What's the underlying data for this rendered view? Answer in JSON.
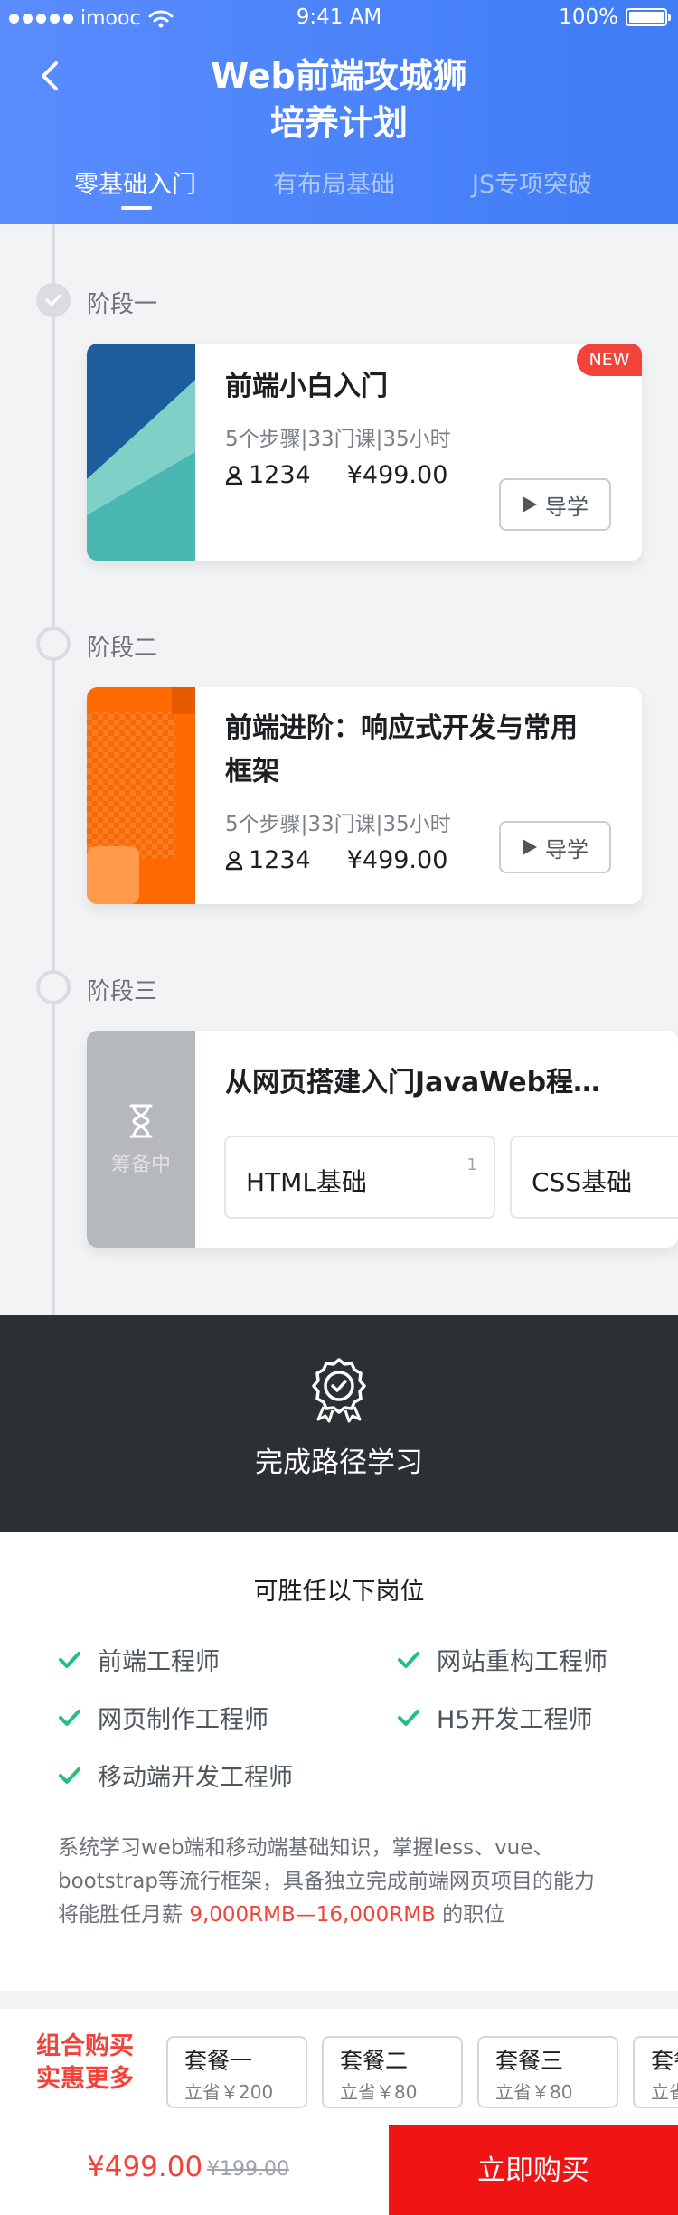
{
  "status_bar": {
    "carrier": "imooc",
    "time": "9:41 AM",
    "battery": "100%"
  },
  "header": {
    "title_line1": "Web前端攻城狮",
    "title_line2": "培养计划",
    "tabs": [
      {
        "label": "零基础入门",
        "active": true
      },
      {
        "label": "有布局基础",
        "active": false
      },
      {
        "label": "JS专项突破",
        "active": false
      }
    ]
  },
  "stages": [
    {
      "label": "阶段一",
      "completed": true
    },
    {
      "label": "阶段二",
      "completed": false
    },
    {
      "label": "阶段三",
      "completed": false
    }
  ],
  "courses": [
    {
      "title": "前端小白入门",
      "meta": "5个步骤|33门课|35小时",
      "learners": "1234",
      "price": "¥499.00",
      "guide_label": "导学",
      "badge": "NEW"
    },
    {
      "title_line1": "前端进阶：响应式开发与常用",
      "title_line2": "框架",
      "meta": "5个步骤|33门课|35小时",
      "learners": "1234",
      "price": "¥499.00",
      "guide_label": "导学"
    },
    {
      "title": "从网页搭建入门JavaWeb程…",
      "cover_label": "筹备中",
      "chips": [
        {
          "label": "HTML基础",
          "num": "1"
        },
        {
          "label": "CSS基础"
        }
      ]
    }
  ],
  "completion": {
    "title": "完成路径学习"
  },
  "jobs": {
    "title": "可胜任以下岗位",
    "items": [
      "前端工程师",
      "网站重构工程师",
      "网页制作工程师",
      "H5开发工程师",
      "移动端开发工程师"
    ],
    "desc_line1": "系统学习web端和移动端基础知识，掌握less、vue、",
    "desc_line2": "bootstrap等流行框架，具备独立完成前端网页项目的能力",
    "desc_line3_prefix": "将能胜任月薪 ",
    "salary": "9,000RMB—16,000RMB",
    "desc_line3_suffix": " 的职位"
  },
  "combo": {
    "label_line1": "组合购买",
    "label_line2": "实惠更多",
    "packages": [
      {
        "name": "套餐一",
        "save": "立省￥200"
      },
      {
        "name": "套餐二",
        "save": "立省￥80"
      },
      {
        "name": "套餐三",
        "save": "立省￥80"
      },
      {
        "name": "套餐",
        "save": "立省"
      }
    ]
  },
  "footer": {
    "price": "¥499.00",
    "original_price": "¥199.00",
    "buy_label": "立即购买"
  },
  "colors": {
    "brand_blue": "#4a82f8",
    "accent_red": "#f2433b",
    "buy_red": "#f01414",
    "dark": "#2b3033",
    "check_green": "#22c07a"
  }
}
